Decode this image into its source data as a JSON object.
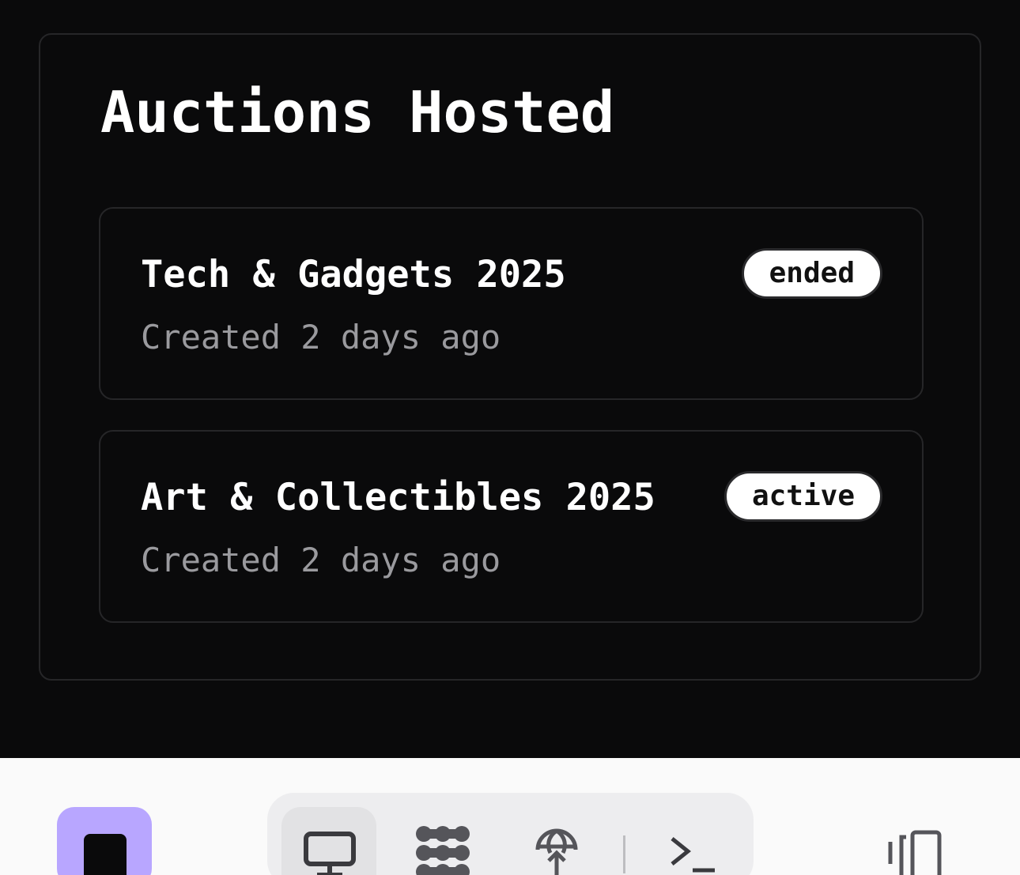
{
  "panel": {
    "title": "Auctions Hosted"
  },
  "auctions": [
    {
      "title": "Tech & Gadgets 2025",
      "created": "Created 2 days ago",
      "status": "ended"
    },
    {
      "title": "Art & Collectibles 2025",
      "created": "Created 2 days ago",
      "status": "active"
    }
  ],
  "colors": {
    "background": "#0a0a0b",
    "card_border": "#262628",
    "text_primary": "#ffffff",
    "text_secondary": "#9a9a9e",
    "badge_bg": "#ffffff",
    "accent": "#b8a6ff",
    "bottom_bar": "#fafafa",
    "toolbar_bg": "#ededef"
  },
  "bottom_bar": {
    "app_icon": "stop-square-icon",
    "tools": [
      {
        "icon": "monitor-icon",
        "active": true
      },
      {
        "icon": "nodes-icon",
        "active": false
      },
      {
        "icon": "globe-upload-icon",
        "active": false
      },
      {
        "icon": "terminal-icon",
        "active": false
      }
    ],
    "side_icon": "device-toggle-icon"
  }
}
